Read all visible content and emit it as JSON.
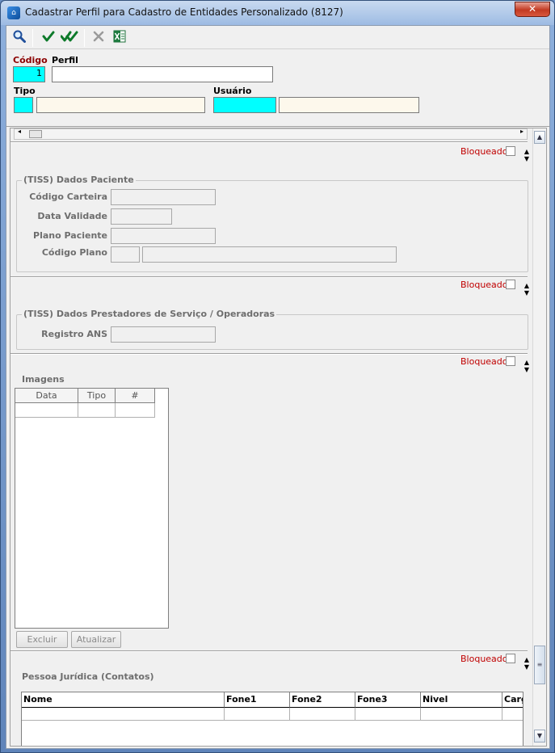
{
  "window": {
    "title": "Cadastrar Perfil para Cadastro de Entidades Personalizado (8127)",
    "close_label": "✕"
  },
  "toolbar": {
    "search_icon": "magnifier-icon",
    "confirm_icon": "check-icon",
    "confirm_all_icon": "double-check-icon",
    "cancel_icon": "x-icon",
    "excel_icon": "excel-icon"
  },
  "form": {
    "codigo_label": "Código",
    "codigo_value": "1",
    "perfil_label": "Perfil",
    "perfil_value": "",
    "tipo_label": "Tipo",
    "tipo_code": "",
    "tipo_desc": "",
    "usuario_label": "Usuário",
    "usuario_code": "",
    "usuario_desc": ""
  },
  "sections": {
    "bloqueado_label": "Bloqueado",
    "tiss_paciente": {
      "title": "(TISS) Dados Paciente",
      "codigo_carteira": "Código Carteira",
      "data_validade": "Data Validade",
      "plano_paciente": "Plano Paciente",
      "codigo_plano": "Código Plano"
    },
    "tiss_prestadores": {
      "title": "(TISS) Dados Prestadores de Serviço / Operadoras",
      "registro_ans": "Registro ANS"
    },
    "imagens": {
      "title": "Imagens",
      "columns": [
        "Data",
        "Tipo",
        "#"
      ],
      "excluir_label": "Excluir",
      "atualizar_label": "Atualizar"
    },
    "pessoa_juridica": {
      "title": "Pessoa Jurídica (Contatos)",
      "columns": [
        "Nome",
        "Fone1",
        "Fone2",
        "Fone3",
        "Nivel",
        "Cargo"
      ]
    }
  },
  "colors": {
    "required_input": "#00ffff",
    "readonly_input": "#fdf8ec",
    "bloqueado_text": "#c00000",
    "required_label": "#8b0000"
  }
}
